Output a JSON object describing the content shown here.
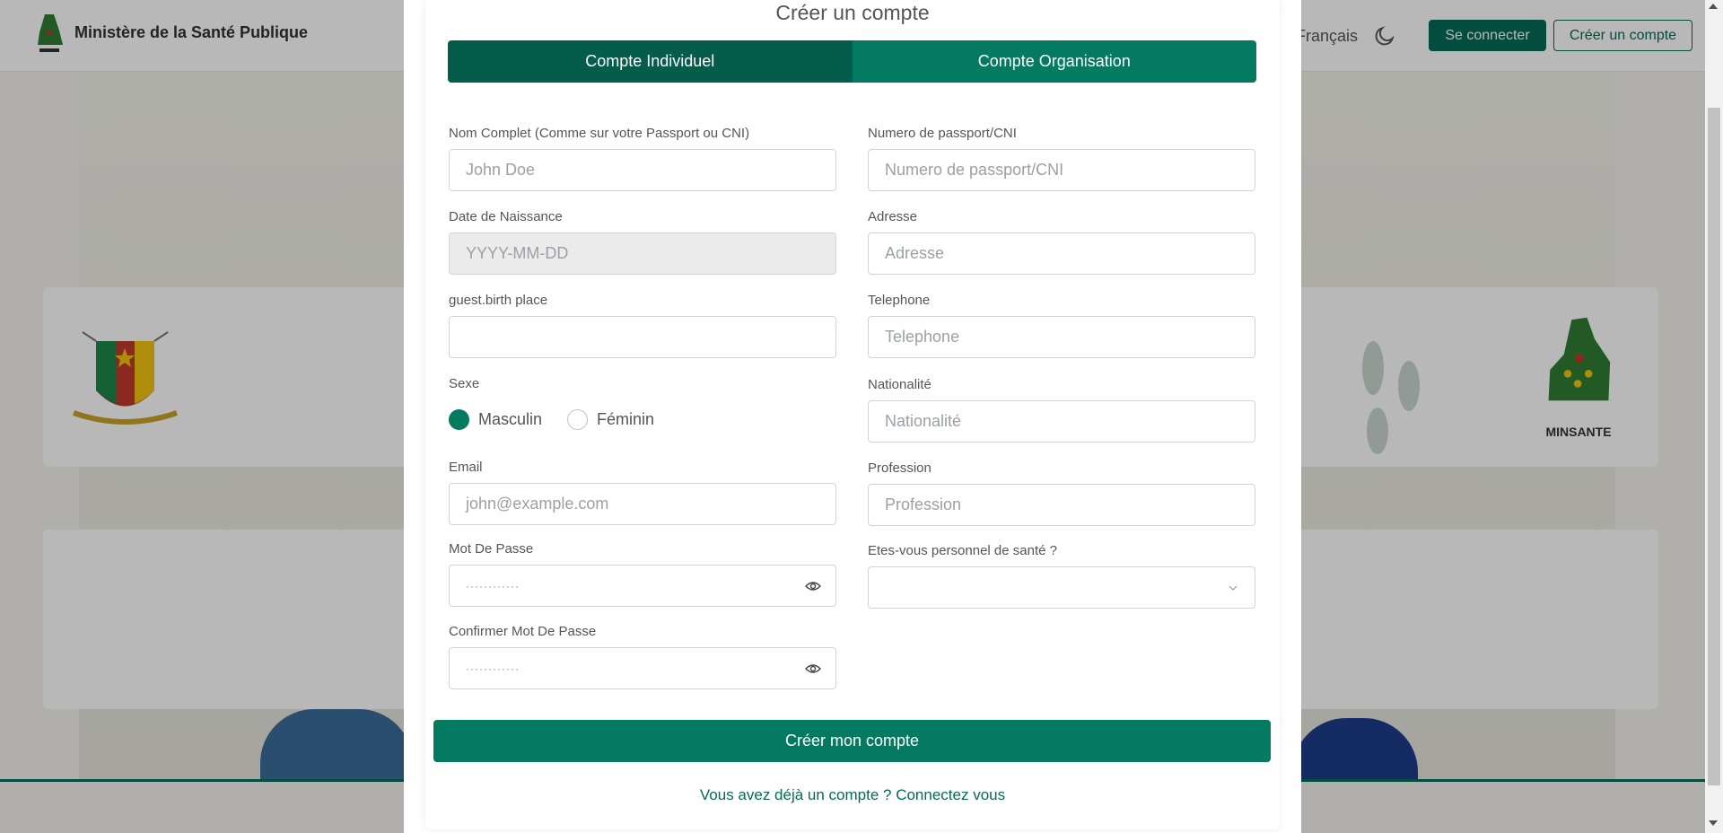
{
  "navbar": {
    "title": "Ministère de la Santé Publique",
    "language": "Français",
    "login_label": "Se connecter",
    "signup_label": "Créer un compte"
  },
  "background": {
    "logo_text": "MINSANTE"
  },
  "modal": {
    "title": "Créer un compte",
    "tabs": [
      {
        "label": "Compte Individuel",
        "active": true
      },
      {
        "label": "Compte Organisation",
        "active": false
      }
    ],
    "left_fields": {
      "full_name": {
        "label": "Nom Complet (Comme sur votre Passport ou CNI)",
        "placeholder": "John Doe"
      },
      "birth_date": {
        "label": "Date de Naissance",
        "placeholder": "YYYY-MM-DD"
      },
      "birth_place": {
        "label": "guest.birth place",
        "placeholder": ""
      },
      "sex": {
        "label": "Sexe",
        "options": [
          "Masculin",
          "Féminin"
        ],
        "selected": "Masculin"
      },
      "email": {
        "label": "Email",
        "placeholder": "john@example.com"
      },
      "password": {
        "label": "Mot De Passe",
        "placeholder": "············"
      },
      "confirm_password": {
        "label": "Confirmer Mot De Passe",
        "placeholder": "············"
      }
    },
    "right_fields": {
      "passport": {
        "label": "Numero de passport/CNI",
        "placeholder": "Numero de passport/CNI"
      },
      "address": {
        "label": "Adresse",
        "placeholder": "Adresse"
      },
      "phone": {
        "label": "Telephone",
        "placeholder": "Telephone"
      },
      "nationality": {
        "label": "Nationalité",
        "placeholder": "Nationalité"
      },
      "profession": {
        "label": "Profession",
        "placeholder": "Profession"
      },
      "health_staff": {
        "label": "Etes-vous personnel de santé ?",
        "value": ""
      }
    },
    "submit_label": "Créer mon compte",
    "login_prompt": "Vous avez déjà un compte ? Connectez vous"
  },
  "colors": {
    "primary": "#047a60",
    "primary_dark": "#035d4a"
  },
  "icons": [
    "eye-icon",
    "moon-icon",
    "chevron-down-icon",
    "coat-of-arms-logo",
    "minsante-logo"
  ]
}
